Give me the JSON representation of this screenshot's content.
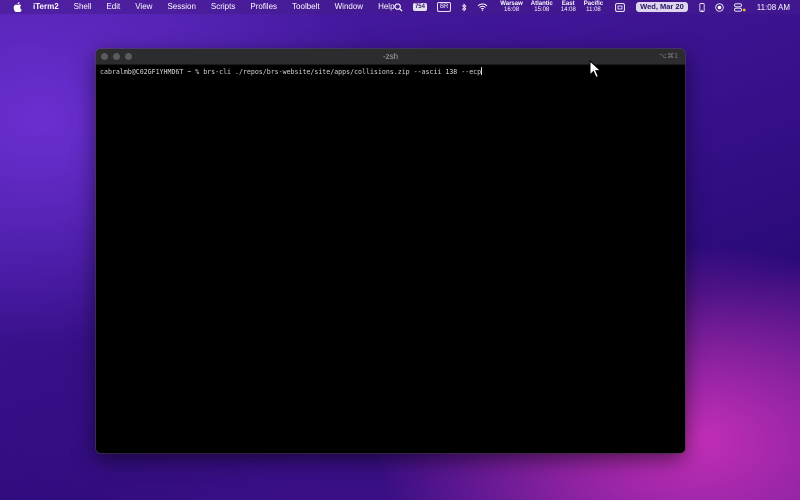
{
  "menubar": {
    "app_name": "iTerm2",
    "items": [
      "Shell",
      "Edit",
      "View",
      "Session",
      "Scripts",
      "Profiles",
      "Toolbelt",
      "Window",
      "Help"
    ],
    "status": {
      "badge_filled": "754",
      "badge_outline": "BR",
      "world_clocks": [
        {
          "city": "Warsaw",
          "time": "16:08"
        },
        {
          "city": "Atlantic",
          "time": "15:08"
        },
        {
          "city": "East",
          "time": "14:08"
        },
        {
          "city": "Pacific",
          "time": "11:08"
        }
      ],
      "date": "Wed, Mar 20",
      "time": "11:08 AM"
    }
  },
  "terminal": {
    "title": "-zsh",
    "shortcut": "⌥⌘1",
    "command_line": "cabralmb@C02GF1YHMD6T ~ % brs-cli ./repos/brs-website/site/apps/collisions.zip --ascii 138 --ecp"
  },
  "colors": {
    "terminal_background": "#000000",
    "terminal_text": "#d6d6d6",
    "titlebar": "#2c2c2e",
    "menubar_tint": "#461c8c"
  },
  "icons": [
    "apple-icon",
    "search-icon",
    "bluetooth-icon",
    "wifi-icon",
    "screenshot-icon",
    "phone-icon",
    "record-icon",
    "control-center-icon",
    "mouse-pointer-icon"
  ]
}
